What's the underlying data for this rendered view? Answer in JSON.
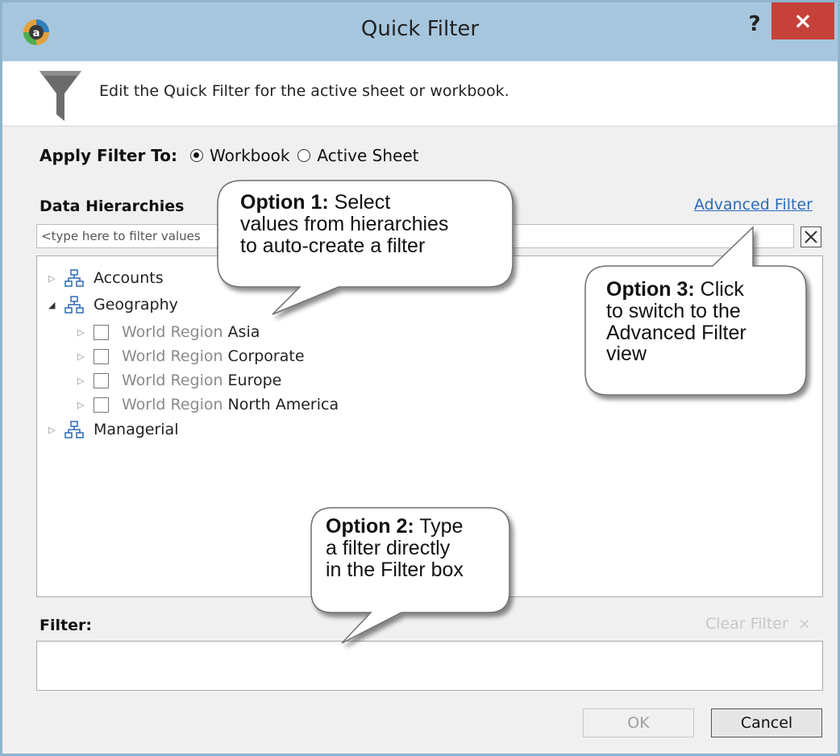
{
  "window": {
    "title": "Quick Filter",
    "help_glyph": "?",
    "close_glyph": "×"
  },
  "banner": {
    "text": "Edit the Quick Filter for the active sheet or workbook."
  },
  "apply_filter": {
    "label": "Apply Filter To:",
    "options": [
      {
        "label": "Workbook",
        "selected": true
      },
      {
        "label": "Active Sheet",
        "selected": false
      }
    ]
  },
  "hierarchies": {
    "label": "Data Hierarchies",
    "advanced_link": "Advanced Filter",
    "search_placeholder": "<type here to filter values",
    "clear_glyph": "×",
    "items": [
      {
        "label": "Accounts",
        "expanded": false
      },
      {
        "label": "Geography",
        "expanded": true,
        "children": [
          {
            "level": "World Region",
            "member": "Asia"
          },
          {
            "level": "World Region",
            "member": "Corporate"
          },
          {
            "level": "World Region",
            "member": "Europe"
          },
          {
            "level": "World Region",
            "member": "North America"
          }
        ]
      },
      {
        "label": "Managerial",
        "expanded": false
      }
    ]
  },
  "filter": {
    "label": "Filter:",
    "clear_label": "Clear Filter",
    "clear_glyph": "×",
    "value": ""
  },
  "buttons": {
    "ok": "OK",
    "cancel": "Cancel"
  },
  "callouts": [
    {
      "title": "Option 1:",
      "lines": [
        "Select",
        "values from hierarchies",
        "to auto-create a filter"
      ]
    },
    {
      "title": "Option 2:",
      "lines": [
        "Type",
        "a filter directly",
        "in the Filter box"
      ]
    },
    {
      "title": "Option 3:",
      "lines": [
        "Click",
        "to switch to the",
        "Advanced Filter",
        "view"
      ]
    }
  ],
  "colors": {
    "titlebar": "#a6c6dd",
    "close": "#c7413b",
    "link": "#2c6bbd"
  }
}
